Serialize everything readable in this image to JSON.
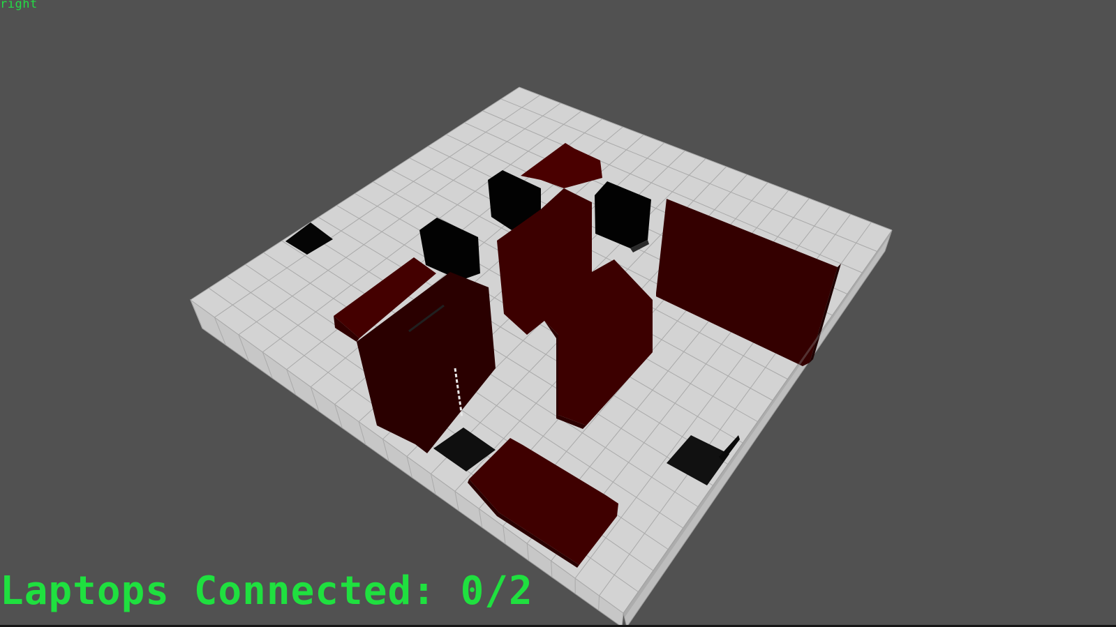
{
  "hud": {
    "camera_label": "right",
    "status_text": "Laptops Connected: 0/2"
  },
  "laptops": {
    "connected": 0,
    "total": 2
  },
  "colors": {
    "background": "#515151",
    "floor_top": "#d3d3d3",
    "floor_side": "#c6c6c6",
    "grid_line": "#aaaaaa",
    "wall_top": "#3e0000",
    "wall_side": "#300000",
    "block": "#020202",
    "hud_text": "#1fe03f"
  },
  "scene": {
    "floor": {
      "columns": 18,
      "rows": 18
    },
    "objects": [
      {
        "kind": "black-block"
      },
      {
        "kind": "black-block"
      },
      {
        "kind": "black-block"
      },
      {
        "kind": "dark-red-wall"
      },
      {
        "kind": "dark-red-wall"
      },
      {
        "kind": "dark-red-wall"
      },
      {
        "kind": "dark-red-wall"
      },
      {
        "kind": "laptop-pad"
      },
      {
        "kind": "laptop-pad"
      },
      {
        "kind": "laptop-pad"
      }
    ]
  }
}
